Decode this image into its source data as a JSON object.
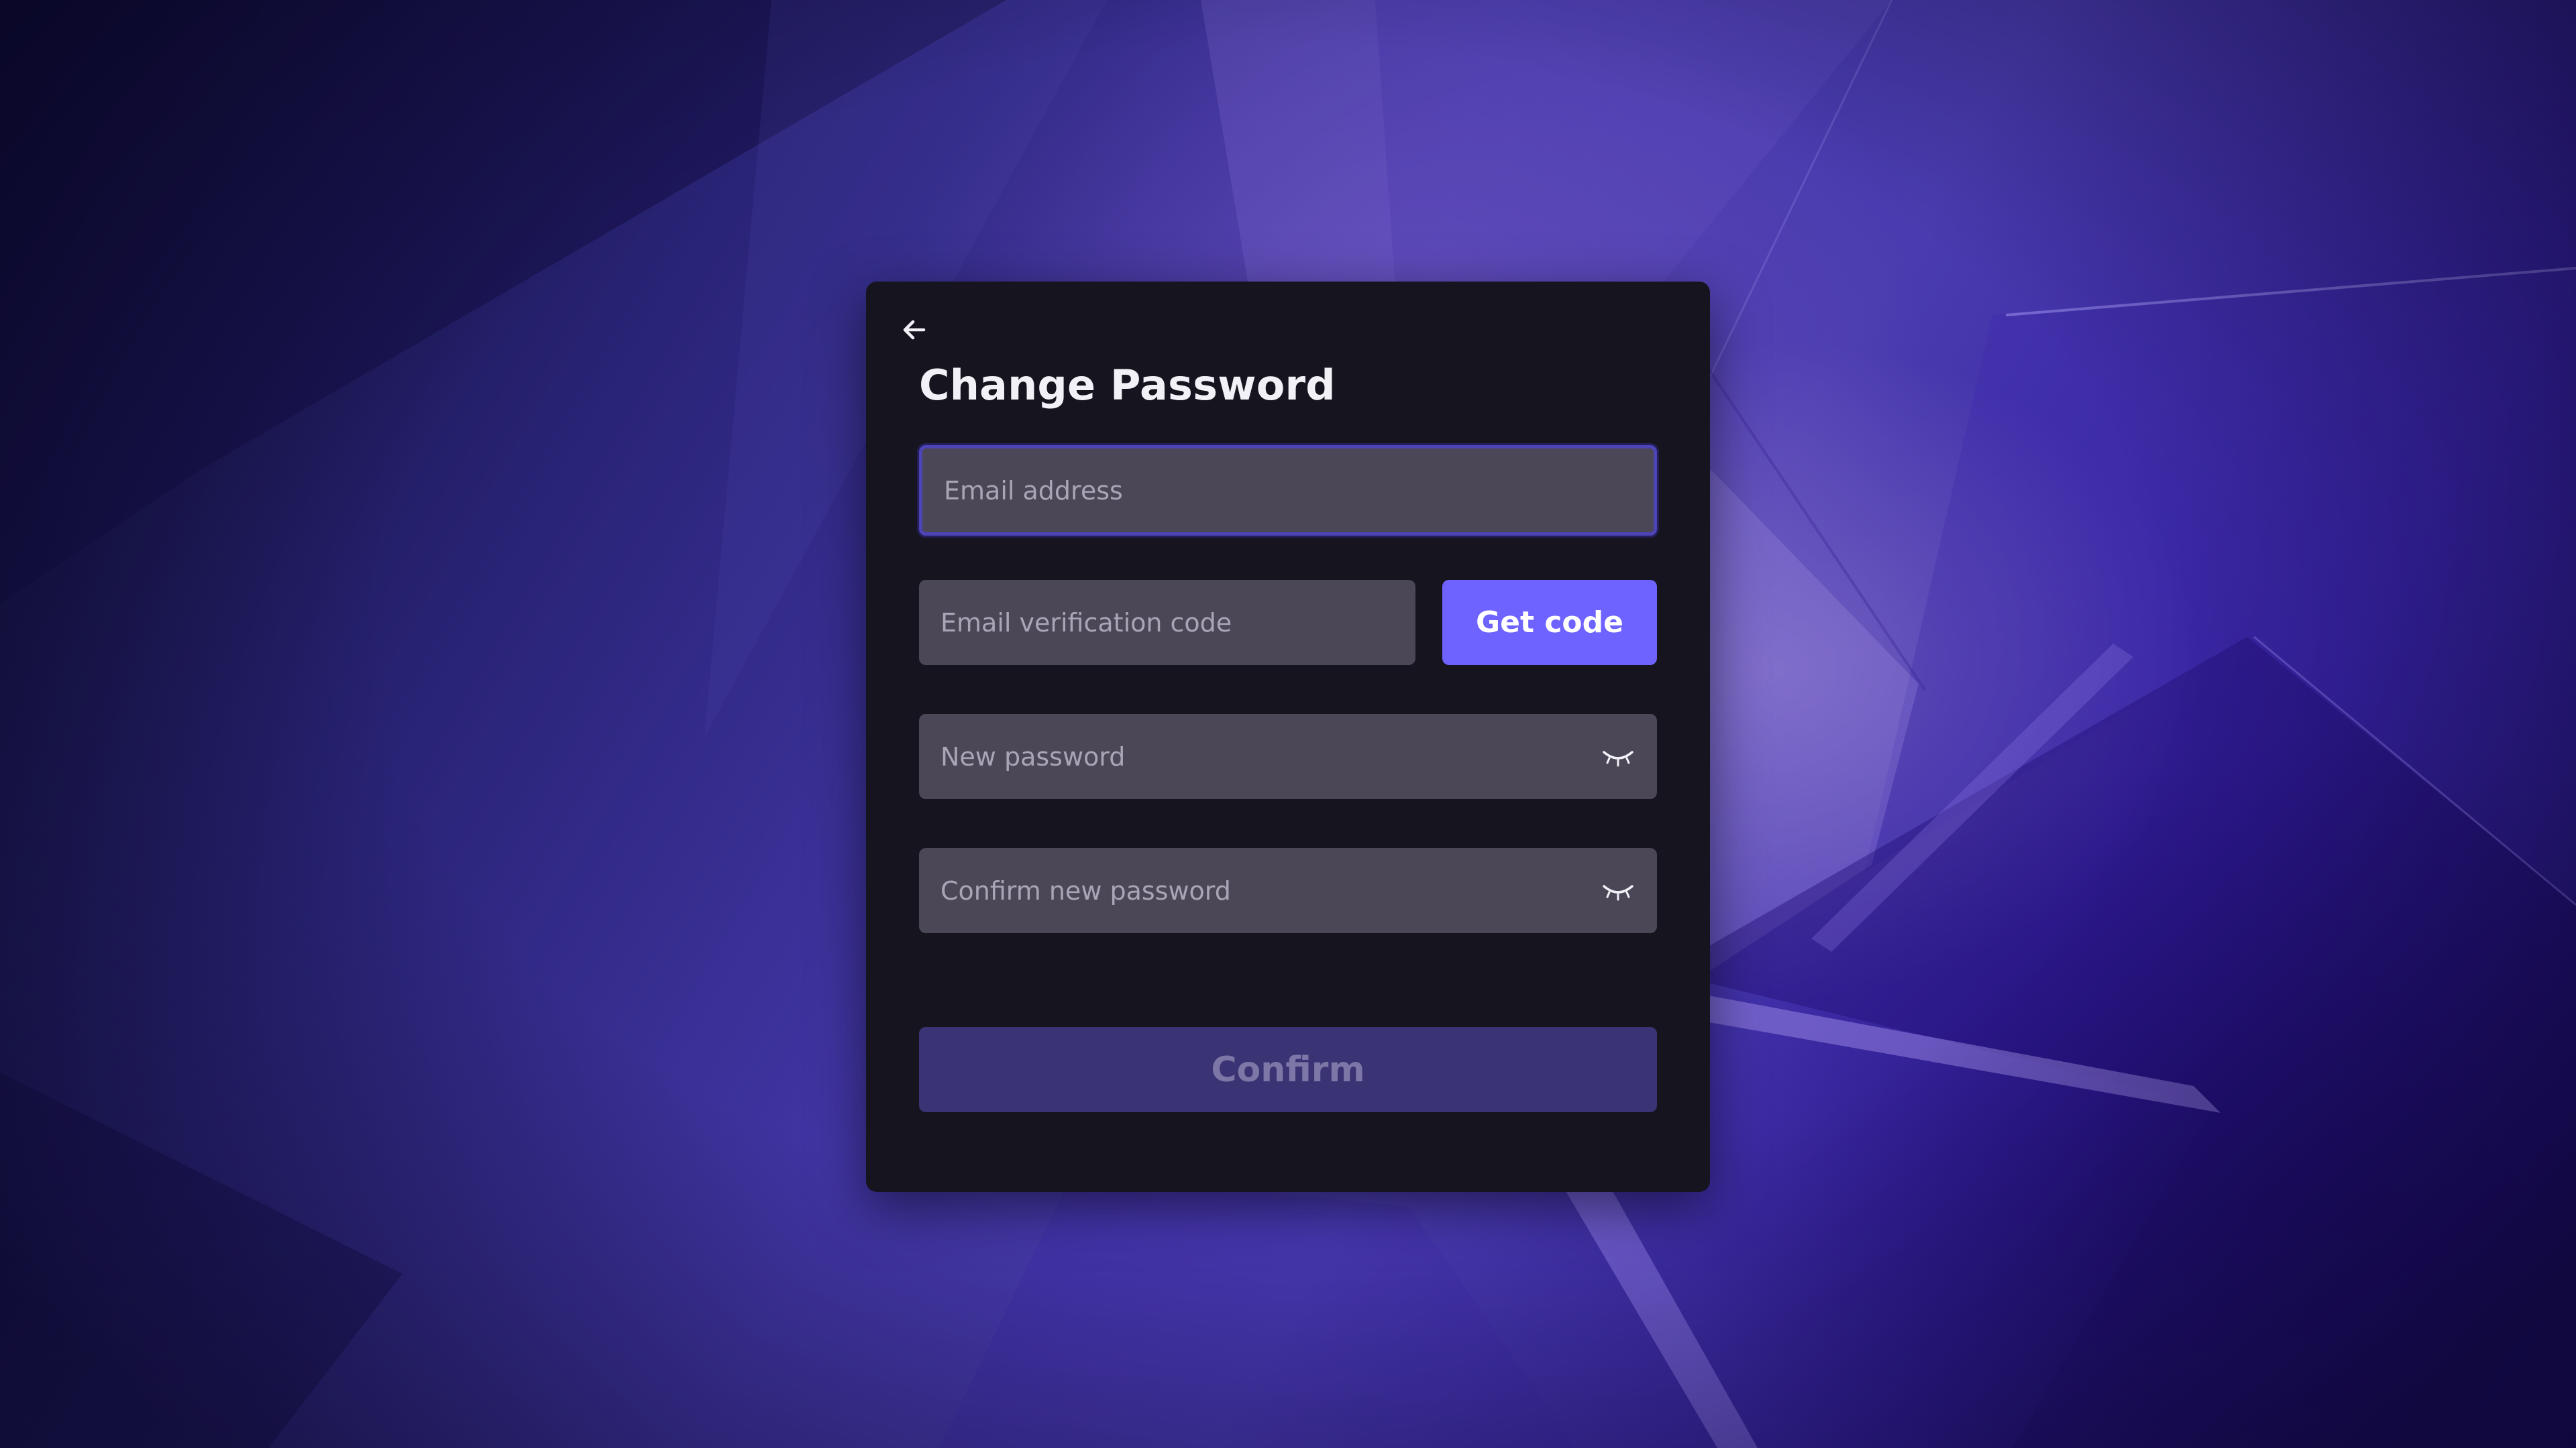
{
  "dialog": {
    "title": "Change Password",
    "back_icon": "arrow-left-icon",
    "fields": {
      "email": {
        "placeholder": "Email address",
        "value": ""
      },
      "verification_code": {
        "placeholder": "Email verification code",
        "value": ""
      },
      "new_password": {
        "placeholder": "New password",
        "value": "",
        "toggle_icon": "eye-closed-icon"
      },
      "confirm_password": {
        "placeholder": "Confirm new password",
        "value": "",
        "toggle_icon": "eye-closed-icon"
      }
    },
    "get_code_label": "Get code",
    "confirm_label": "Confirm"
  },
  "colors": {
    "dialog_background": "#16151f",
    "field_background": "#4b4757",
    "accent": "#6f63ff",
    "confirm_disabled": "#3b3474",
    "focus_border": "#4d44b6"
  }
}
